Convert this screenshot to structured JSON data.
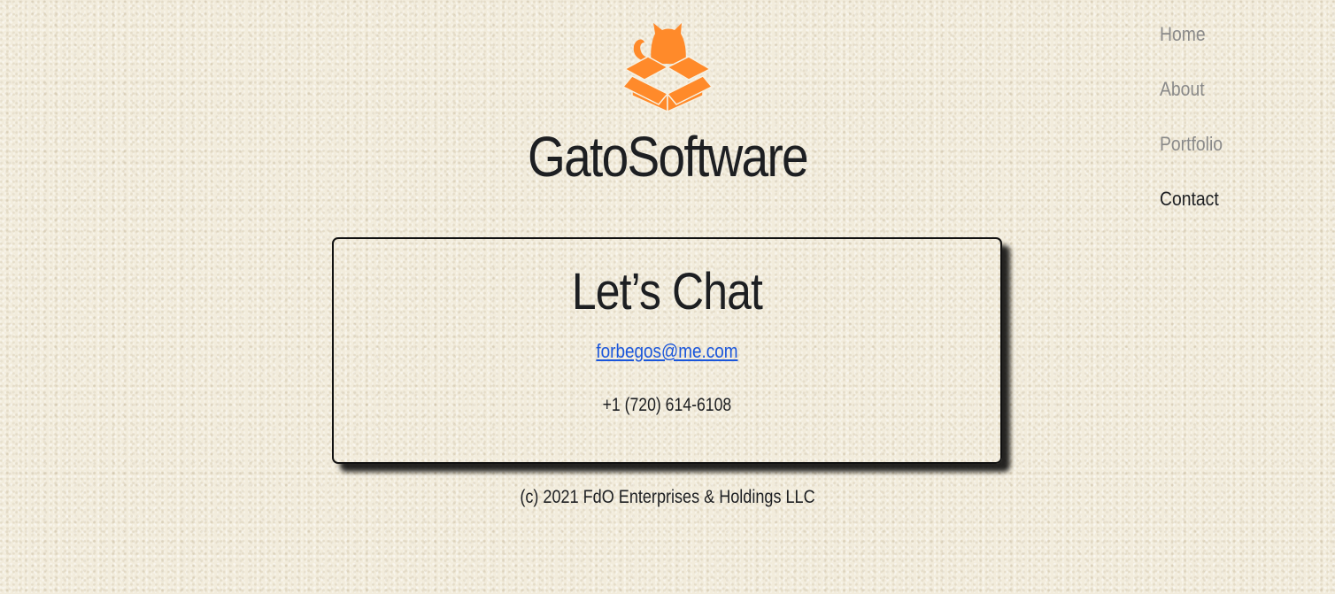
{
  "brand": {
    "name": "GatoSoftware",
    "logo_icon": "cat-in-box-icon",
    "logo_color": "#ff8a2a"
  },
  "nav": {
    "items": [
      {
        "label": "Home",
        "active": false
      },
      {
        "label": "About",
        "active": false
      },
      {
        "label": "Portfolio",
        "active": false
      },
      {
        "label": "Contact",
        "active": true
      }
    ]
  },
  "contact": {
    "heading": "Let’s Chat",
    "email": "forbegos@me.com",
    "phone": "+1 (720) 614-6108"
  },
  "footer": {
    "copyright": "(c) 2021 FdO Enterprises & Holdings LLC"
  },
  "colors": {
    "link": "#1a56db",
    "text": "#1d1f22",
    "nav_inactive": "#8a8a8a",
    "background": "#f2ecdc"
  }
}
